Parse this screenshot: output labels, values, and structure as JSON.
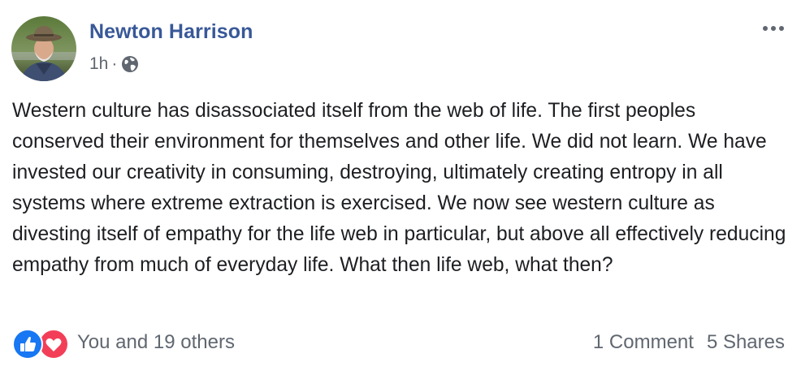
{
  "post": {
    "author": "Newton Harrison",
    "time": "1h",
    "separator": "·",
    "privacy_icon": "globe-icon",
    "menu_icon": "more-options-icon",
    "text": "Western culture has disassociated itself from the web of life. The first peoples conserved their environment for themselves and other life. We did not learn. We have invested our creativity in consuming, destroying, ultimately creating entropy in all systems where extreme extraction is exercised. We now see western culture as divesting itself of empathy for the life web in particular, but above all effectively reducing empathy from much of everyday life. What then life web, what then?"
  },
  "engagement": {
    "reaction_icons": [
      "like-icon",
      "love-icon"
    ],
    "reaction_summary": "You and 19 others",
    "comments": "1 Comment",
    "shares": "5 Shares"
  },
  "colors": {
    "author_link": "#385898",
    "secondary_text": "#606770",
    "like_blue": "#1877f2",
    "love_red": "#f33e58"
  }
}
